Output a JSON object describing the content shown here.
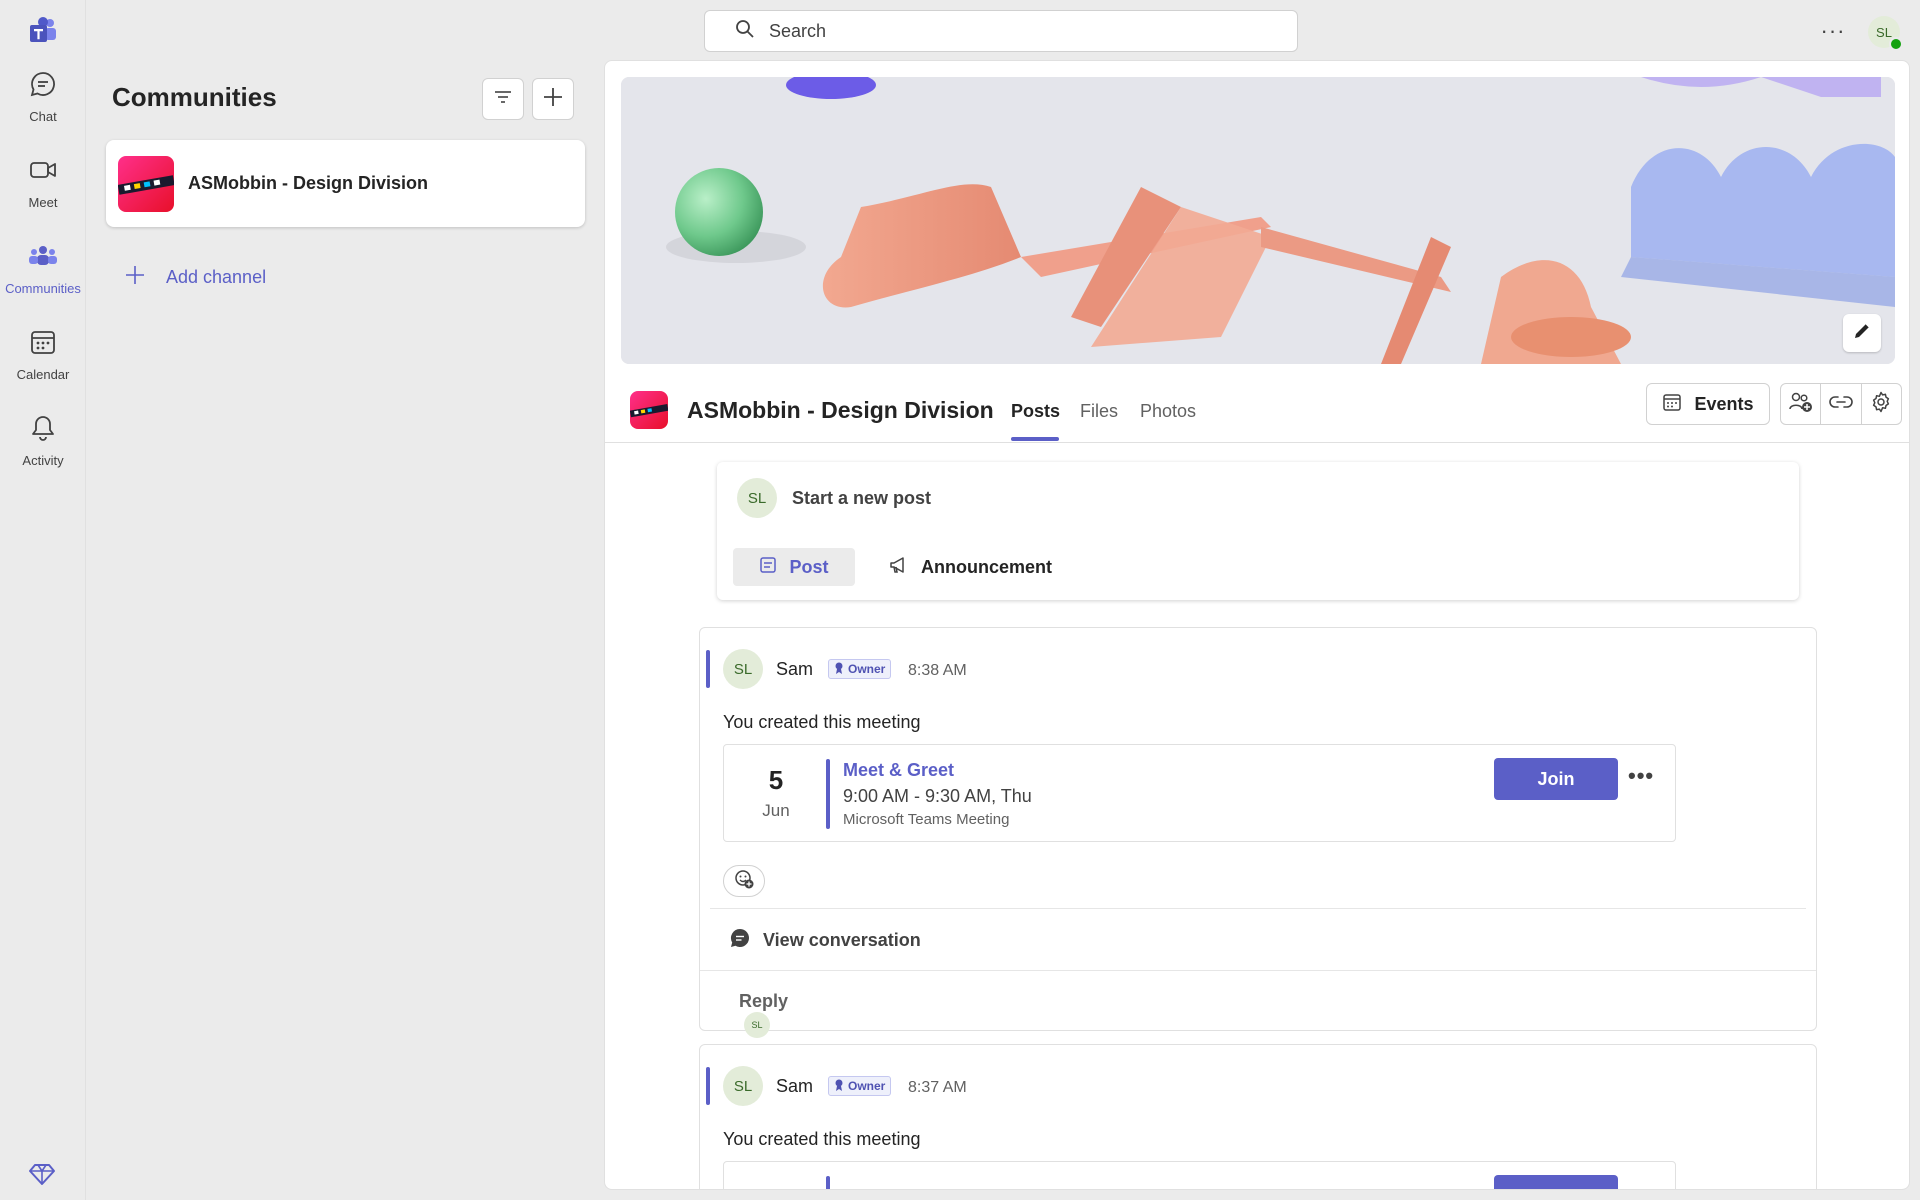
{
  "rail": {
    "items": [
      {
        "label": "Chat",
        "icon": "chat-icon"
      },
      {
        "label": "Meet",
        "icon": "video-icon"
      },
      {
        "label": "Communities",
        "icon": "communities-icon"
      },
      {
        "label": "Calendar",
        "icon": "calendar-icon"
      },
      {
        "label": "Activity",
        "icon": "bell-icon"
      }
    ],
    "active": "Communities"
  },
  "topbar": {
    "search_placeholder": "Search",
    "more_label": "···",
    "user_initials": "SL"
  },
  "sidebar": {
    "title": "Communities",
    "community_name": "ASMobbin - Design Division",
    "add_channel_label": "Add channel"
  },
  "community": {
    "name": "ASMobbin - Design Division",
    "tabs": [
      {
        "label": "Posts"
      },
      {
        "label": "Files"
      },
      {
        "label": "Photos"
      }
    ],
    "active_tab": "Posts",
    "events_label": "Events"
  },
  "compose": {
    "avatar_initials": "SL",
    "placeholder": "Start a new post",
    "post_label": "Post",
    "announcement_label": "Announcement"
  },
  "posts": [
    {
      "avatar_initials": "SL",
      "author": "Sam",
      "role": "Owner",
      "time": "8:38 AM",
      "description": "You created this meeting",
      "meeting": {
        "day": "5",
        "month": "Jun",
        "title": "Meet & Greet",
        "time": "9:00 AM - 9:30 AM, Thu",
        "type": "Microsoft Teams Meeting",
        "join_label": "Join",
        "more_label": "•••"
      },
      "view_conversation_label": "View conversation",
      "reply_initials": "SL",
      "reply_label": "Reply"
    },
    {
      "avatar_initials": "SL",
      "author": "Sam",
      "role": "Owner",
      "time": "8:37 AM",
      "description": "You created this meeting"
    }
  ],
  "colors": {
    "accent": "#5b5fc7",
    "background": "#ebebeb",
    "presence": "#13a10e"
  }
}
